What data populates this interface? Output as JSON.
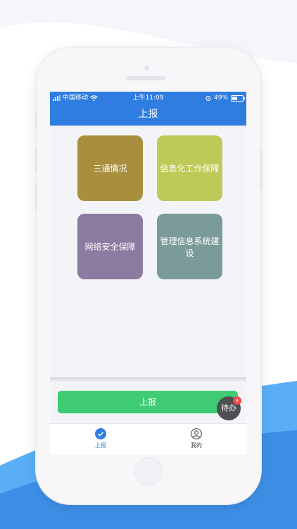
{
  "status_bar": {
    "carrier": "中国移动",
    "time": "上午11:09",
    "battery": "49%"
  },
  "header": {
    "title": "上报"
  },
  "tiles": [
    {
      "label": "三通情况",
      "color": "#a88f3e"
    },
    {
      "label": "信息化工作保障",
      "color": "#bccb58"
    },
    {
      "label": "网络安全保障",
      "color": "#8d7aa1"
    },
    {
      "label": "管理信息系统建设",
      "color": "#7a9b99"
    }
  ],
  "actions": {
    "report_label": "上报",
    "todo_label": "待办",
    "todo_badge": "4"
  },
  "tabbar": {
    "items": [
      {
        "label": "上报",
        "icon": "check-circle-icon",
        "active": true
      },
      {
        "label": "我的",
        "icon": "user-icon",
        "active": false
      }
    ]
  },
  "colors": {
    "header": "#2f7de1",
    "report_button": "#3ecb72",
    "tab_active": "#2f7de1",
    "tab_inactive": "#444444"
  }
}
